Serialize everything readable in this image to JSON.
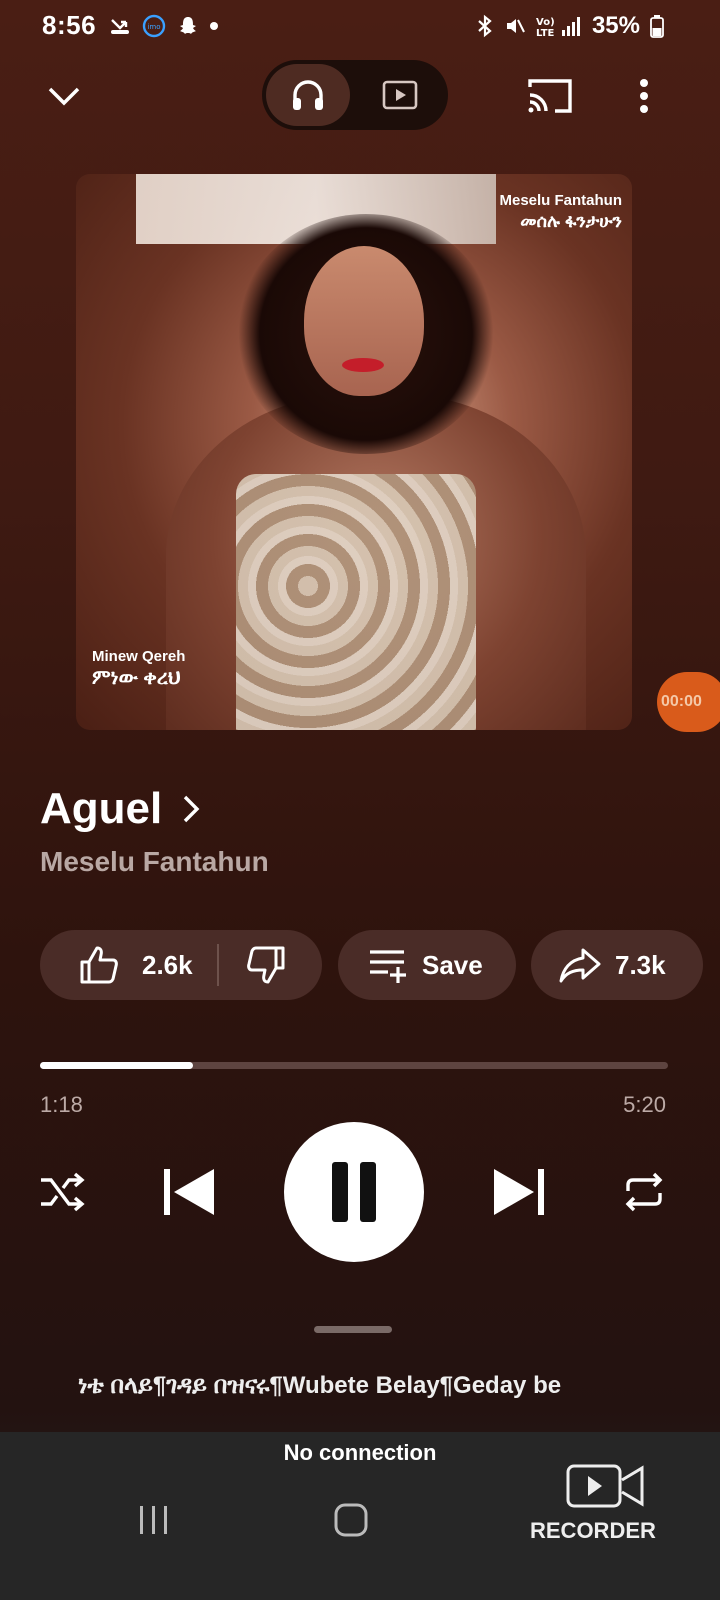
{
  "status_bar": {
    "time": "8:56",
    "battery": "35%",
    "network": "Vo) LTE"
  },
  "top_bar": {
    "audio_label": "Song",
    "video_label": "Video"
  },
  "album_art": {
    "artist_latin": "Meselu Fantahun",
    "artist_amharic": "መሰሉ ፋንታሁን",
    "song_latin": "Minew Qereh",
    "song_amharic": "ምነው ቀረህ"
  },
  "floating_timer": "00:00",
  "track": {
    "title": "Aguel",
    "artist": "Meselu Fantahun"
  },
  "actions": {
    "like_count": "2.6k",
    "save_label": "Save",
    "share_count": "7.3k"
  },
  "progress": {
    "current": "1:18",
    "total": "5:20",
    "fraction": 0.244
  },
  "lyrics_preview": "ነቴ በላይ¶ገዳይ በዝናሩ¶Wubete Belay¶Geday be",
  "bottom": {
    "no_connection": "No connection",
    "recorder_label": "RECORDER"
  },
  "colors": {
    "background_top": "#4a1e14",
    "chip_bg": "#4a2c27",
    "timer_bubble": "#d95b1b",
    "nav_bg": "#262626"
  }
}
